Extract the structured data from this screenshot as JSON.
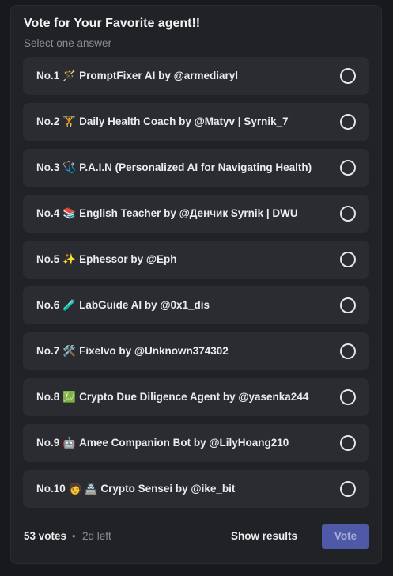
{
  "poll": {
    "title": "Vote for Your Favorite agent!!",
    "subtitle": "Select one answer"
  },
  "answers": [
    {
      "no": "No.1",
      "emoji": "🪄",
      "emoji_name": "magic-wand-icon",
      "text": "PromptFixer AI by @armediaryl"
    },
    {
      "no": "No.2",
      "emoji": "🏋️",
      "emoji_name": "weightlifter-icon",
      "text": "Daily Health Coach by @Matyv | Syrnik_7"
    },
    {
      "no": "No.3",
      "emoji": "🩺",
      "emoji_name": "stethoscope-icon",
      "text": "P.A.I.N (Personalized AI for Navigating Health)"
    },
    {
      "no": "No.4",
      "emoji": "📚",
      "emoji_name": "books-icon",
      "text": "English Teacher by @Денчик Syrnik | DWU_"
    },
    {
      "no": "No.5",
      "emoji": "✨",
      "emoji_name": "sparkles-icon",
      "text": "Ephessor by @Eph"
    },
    {
      "no": "No.6",
      "emoji": "🧪",
      "emoji_name": "test-tube-icon",
      "text": "LabGuide AI by @0x1_dis"
    },
    {
      "no": "No.7",
      "emoji": "🛠️",
      "emoji_name": "tools-icon",
      "text": "Fixelvo by @Unknown374302"
    },
    {
      "no": "No.8",
      "emoji": "💹",
      "emoji_name": "chart-increasing-icon",
      "text": "Crypto Due Diligence Agent by @yasenka244"
    },
    {
      "no": "No.9",
      "emoji": "🤖",
      "emoji_name": "robot-icon",
      "text": "Amee Companion Bot by @LilyHoang210"
    },
    {
      "no": "No.10",
      "emoji": "🧑",
      "emoji_name": "person-icon",
      "emoji2": "🏯",
      "emoji2_name": "temple-icon",
      "text": "Crypto Sensei by @ike_bit"
    }
  ],
  "footer": {
    "votes": "53 votes",
    "separator": "•",
    "time_left": "2d left",
    "show_results_label": "Show results",
    "vote_label": "Vote"
  },
  "colors": {
    "background": "#18191c",
    "card": "#202226",
    "answer_bg": "#2a2c31",
    "vote_button": "#4e5aa8"
  }
}
